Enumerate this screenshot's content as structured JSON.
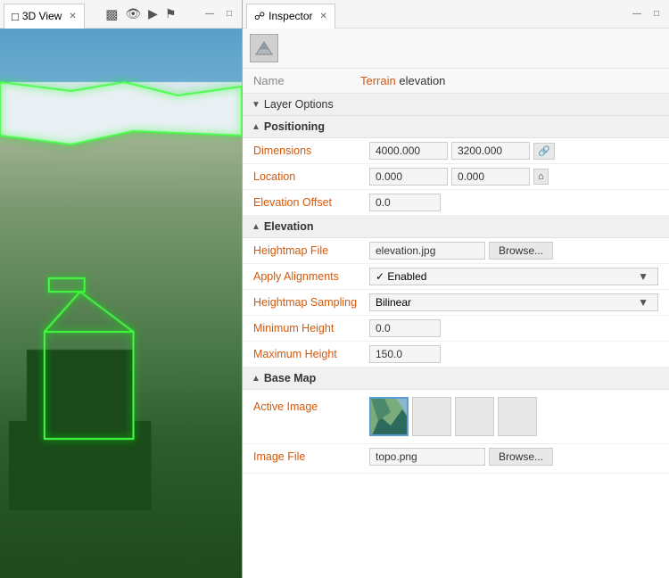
{
  "leftPanel": {
    "title": "3D View",
    "tabIcons": [
      "bar-chart",
      "eye",
      "camera",
      "bookmark"
    ]
  },
  "rightPanel": {
    "title": "Inspector",
    "terrainIconAlt": "terrain-layer-icon",
    "nameLabel": "Name",
    "nameValueHighlighted": "Terrain",
    "nameValueNormal": " elevation",
    "sections": {
      "layerOptions": {
        "label": "Layer Options",
        "collapsed": true
      },
      "positioning": {
        "label": "Positioning",
        "collapsed": false,
        "fields": {
          "dimensionsLabel": "Dimensions",
          "dimensionsVal1": "4000.000",
          "dimensionsVal2": "3200.000",
          "locationLabel": "Location",
          "locationVal1": "0.000",
          "locationVal2": "0.000",
          "elevationOffsetLabel": "Elevation Offset",
          "elevationOffsetVal": "0.0"
        }
      },
      "elevation": {
        "label": "Elevation",
        "collapsed": false,
        "fields": {
          "heightmapFileLabel": "Heightmap File",
          "heightmapFileVal": "elevation.jpg",
          "heightmapFileBrowse": "Browse...",
          "applyAlignmentsLabel": "Apply Alignments",
          "applyAlignmentsVal": "✓ Enabled",
          "heightmapSamplingLabel": "Heightmap Sampling",
          "heightmapSamplingVal": "Bilinear",
          "minimumHeightLabel": "Minimum Height",
          "minimumHeightVal": "0.0",
          "maximumHeightLabel": "Maximum Height",
          "maximumHeightVal": "150.0"
        }
      },
      "baseMap": {
        "label": "Base Map",
        "collapsed": false,
        "fields": {
          "activeImageLabel": "Active Image",
          "imageFileLabel": "Image File",
          "imageFileVal": "topo.png",
          "imageFileBrowse": "Browse..."
        }
      }
    }
  }
}
